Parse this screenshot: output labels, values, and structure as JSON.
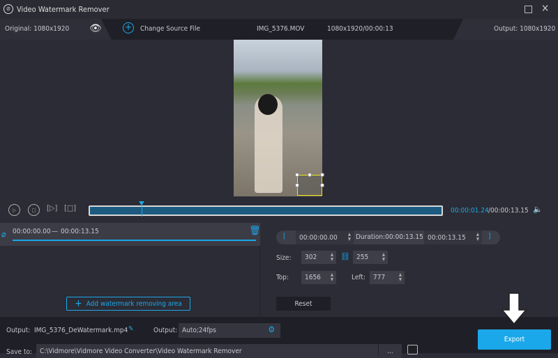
{
  "app": {
    "title": "Video Watermark Remover"
  },
  "infobar": {
    "original": "Original: 1080x1920",
    "change_source": "Change Source File",
    "filename": "IMG_5376.MOV",
    "meta": "1080x1920/00:00:13",
    "output": "Output: 1080x1920"
  },
  "player": {
    "current_time": "00:00:01.24",
    "total_time": "/00:00:13.15",
    "progress": 0.147
  },
  "clip": {
    "range_start": "00:00:00.00",
    "dash": "—",
    "range_end": "00:00:13.15"
  },
  "trim": {
    "start": "00:00:00.00",
    "duration": "Duration:00:00:13.15",
    "end": "00:00:13.15",
    "open_bracket": "[",
    "close_bracket": "]"
  },
  "area": {
    "size_label": "Size:",
    "width": "302",
    "height": "255",
    "top_label": "Top:",
    "top": "1656",
    "left_label": "Left:",
    "left": "777",
    "reset": "Reset"
  },
  "add_area": "Add watermark removing area",
  "bottom": {
    "output_label": "Output:",
    "output_file": "IMG_5376_DeWatermark.mp4",
    "format_label": "Output:",
    "format": "Auto;24fps",
    "save_label": "Save to:",
    "save_path": "C:\\Vidmore\\Vidmore Video Converter\\Video Watermark Remover",
    "more": "...",
    "export": "Export"
  },
  "colors": {
    "accent": "#1ba8ea",
    "selection": "#e6e619"
  }
}
